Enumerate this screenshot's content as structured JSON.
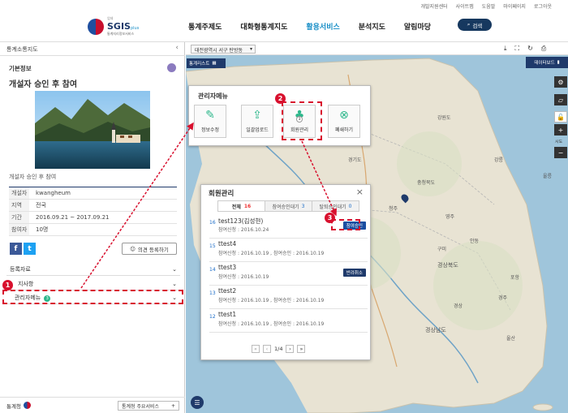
{
  "utility_links": [
    "개발지원센터",
    "사이트맵",
    "도움말",
    "마이페이지",
    "로그아웃"
  ],
  "logo": {
    "name": "SGIS",
    "plus": "plus",
    "sub": "통계지리정보서비스",
    "prefix": "업데"
  },
  "gnb": [
    "통계주제도",
    "대화형통계지도",
    "활용서비스",
    "분석지도",
    "알림마당"
  ],
  "gnb_active": "활용서비스",
  "search_label": "검색",
  "left": {
    "header": "통계소통지도",
    "section_title": "기본정보",
    "community_title": "개설자 승인 후 참여",
    "description": "개설자 승인 후 참여",
    "info": [
      {
        "k": "개설자",
        "v": "kwangheum"
      },
      {
        "k": "지역",
        "v": "전국"
      },
      {
        "k": "기간",
        "v": "2016.09.21 ~ 2017.09.21"
      },
      {
        "k": "참여자",
        "v": "10명"
      }
    ],
    "opinion_button": "의견 등록하기",
    "accordion": [
      {
        "label": "등록자료"
      },
      {
        "label": "지사항"
      },
      {
        "label": "관리자메뉴",
        "badge": "3"
      }
    ],
    "footer_org": "통계청",
    "footer_service": "통계청 주요서비스"
  },
  "map": {
    "region_select": "대전광역시 서구 탄방동",
    "statlist_label": "통계리스트",
    "databoard_label": "데이터보드",
    "zoom_label": "시도",
    "labels": [
      "강원도",
      "경기도",
      "충청북도",
      "경상북도",
      "경상남도",
      "경상",
      "울릉",
      "영주",
      "안동",
      "강릉",
      "대전",
      "청주",
      "포항",
      "경주",
      "울산",
      "구미"
    ]
  },
  "admin_menu": {
    "title": "관리자메뉴",
    "buttons": [
      {
        "label": "정보수정",
        "icon": "edit-icon"
      },
      {
        "label": "일괄업로드",
        "icon": "upload-icon"
      },
      {
        "label": "회원관리",
        "icon": "members-icon",
        "badge": "3"
      },
      {
        "label": "폐쇄하기",
        "icon": "close-circle-icon"
      }
    ]
  },
  "member_popup": {
    "title": "회원관리",
    "tabs": [
      {
        "label": "전체",
        "count": "16"
      },
      {
        "label": "참여승인대기",
        "count": "3"
      },
      {
        "label": "탈퇴승인대기",
        "count": "0"
      }
    ],
    "rows": [
      {
        "num": "16",
        "name": "test123(김성현)",
        "date": "참여신청 : 2016.10.24",
        "action": "참여승인"
      },
      {
        "num": "15",
        "name": "ttest4",
        "date": "참여신청 : 2016.10.19 , 참여승인 : 2016.10.19",
        "action": ""
      },
      {
        "num": "14",
        "name": "ttest3",
        "date": "참여신청 : 2016.10.19",
        "action": "반려취소"
      },
      {
        "num": "13",
        "name": "ttest2",
        "date": "참여신청 : 2016.10.19 , 참여승인 : 2016.10.19",
        "action": ""
      },
      {
        "num": "12",
        "name": "ttest1",
        "date": "참여신청 : 2016.10.19 , 참여승인 : 2016.10.19",
        "action": ""
      }
    ],
    "pager": "1/4"
  },
  "callouts": [
    "1",
    "2",
    "3"
  ],
  "colors": {
    "accent": "#1a8fc7",
    "navy": "#1f3a6b",
    "red": "#d8102e",
    "green": "#2db78b",
    "land": "#e8e3d3",
    "sea": "#9fc5db"
  }
}
